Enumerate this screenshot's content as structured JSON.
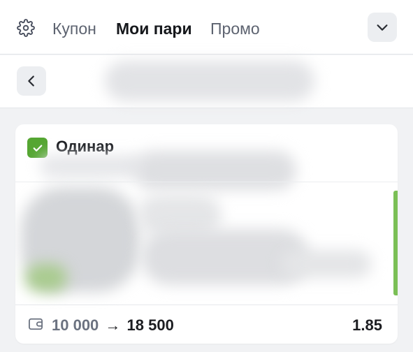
{
  "tabs": [
    {
      "label": "Купон",
      "active": false
    },
    {
      "label": "Мои пари",
      "active": true
    },
    {
      "label": "Промо",
      "active": false
    }
  ],
  "bet_card": {
    "type_label": "Одинар",
    "checked": true,
    "stake": "10 000",
    "arrow": "→",
    "potential_win": "18 500",
    "odds": "1.85"
  },
  "colors": {
    "accent_green": "#55a632",
    "panel_background": "#f1f2f4"
  }
}
